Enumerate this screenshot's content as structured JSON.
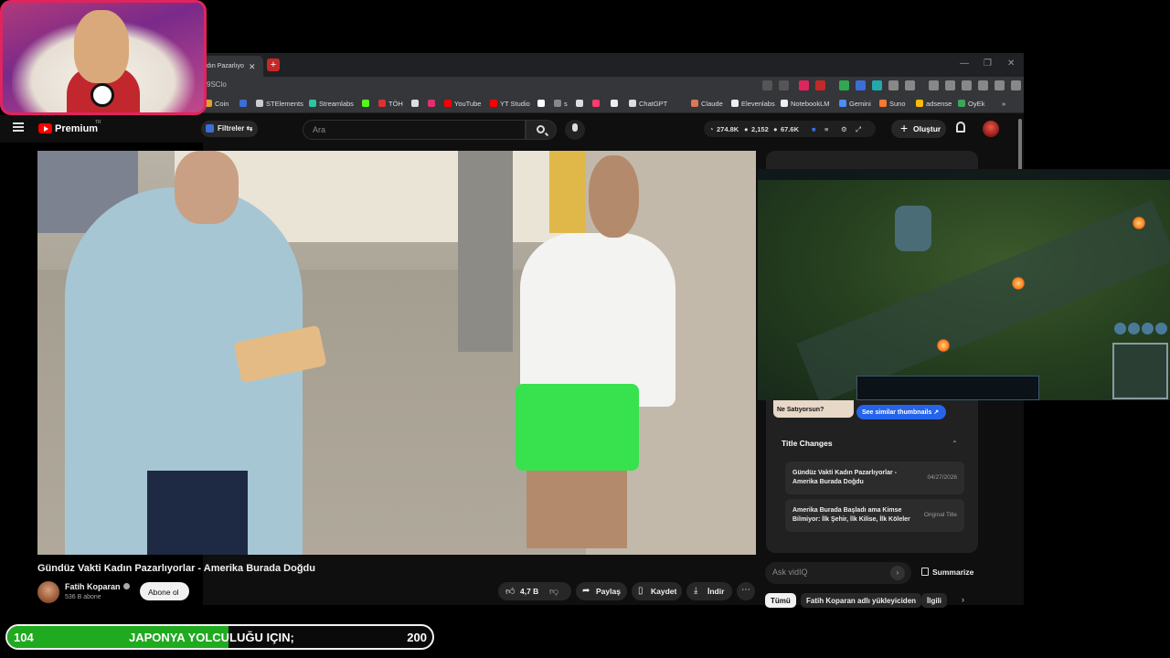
{
  "browser": {
    "tab_title": "dın Pazarlıyo",
    "url_fragment": "9SClo",
    "bookmarks": [
      {
        "label": "Coin",
        "color": "#e0a030"
      },
      {
        "label": "",
        "color": "#3b6fd8"
      },
      {
        "label": "STElements",
        "color": "#cccccc"
      },
      {
        "label": "Streamlabs",
        "color": "#31c3a2"
      },
      {
        "label": "",
        "color": "#53fc18"
      },
      {
        "label": "TÖH",
        "color": "#e03030"
      },
      {
        "label": "",
        "color": "#dddddd"
      },
      {
        "label": "",
        "color": "#e1306c"
      },
      {
        "label": "YouTube",
        "color": "#ff0000"
      },
      {
        "label": "YT Studio",
        "color": "#ff0000"
      },
      {
        "label": "",
        "color": "#ffffff"
      },
      {
        "label": "s",
        "color": "#888888"
      },
      {
        "label": "",
        "color": "#dddddd"
      },
      {
        "label": "",
        "color": "#ff3b6b"
      },
      {
        "label": "",
        "color": "#eeeeee"
      },
      {
        "label": "ChatGPT",
        "color": "#dddddd"
      },
      {
        "label": "Claude",
        "color": "#d97757"
      },
      {
        "label": "Elevenlabs",
        "color": "#eeeeee"
      },
      {
        "label": "NotebookLM",
        "color": "#eeeeee"
      },
      {
        "label": "Gemini",
        "color": "#4c8df6"
      },
      {
        "label": "Suno",
        "color": "#f57a30"
      },
      {
        "label": "adsense",
        "color": "#fbbc05"
      },
      {
        "label": "OyEk",
        "color": "#3aa757"
      }
    ]
  },
  "youtube": {
    "logo_text": "Premium",
    "logo_badge": "TR",
    "filters_label": "Filtreler",
    "search_placeholder": "Ara",
    "stats": {
      "views": "274.8K",
      "subs": "2,152",
      "likes": "67.6K"
    },
    "create_label": "Oluştur"
  },
  "video": {
    "title": "Gündüz Vakti Kadın Pazarlıyorlar - Amerika Burada Doğdu",
    "channel": "Fatih Koparan",
    "subscribers": "536 B abone",
    "subscribe_label": "Abone ol",
    "likes": "4,7 B",
    "share_label": "Paylaş",
    "save_label": "Kaydet",
    "download_label": "İndir"
  },
  "panel": {
    "thumb_caption": "Ne Satıyorsun?",
    "similar_label": "See similar thumbnails ↗",
    "title_changes_heading": "Title Changes",
    "title_changes": [
      {
        "title": "Gündüz Vakti Kadın Pazarlıyorlar - Amerika Burada Doğdu",
        "date": "04/27/2026"
      },
      {
        "title": "Amerika Burada Başladı ama Kimse Bilmiyor: İlk Şehir, İlk Kilise, İlk Köleler",
        "date": "Original Title"
      }
    ],
    "ask_placeholder": "Ask vidIQ",
    "summarize_label": "Summarize",
    "chips": [
      "Tümü",
      "Fatih Koparan adlı yükleyiciden",
      "İlgili"
    ]
  },
  "donation_bar": {
    "current": "104",
    "title": "JAPONYA YOLCULUĞU IÇIN;",
    "goal": "200",
    "progress_fraction": 0.52,
    "fill_color": "#1faa1f"
  }
}
